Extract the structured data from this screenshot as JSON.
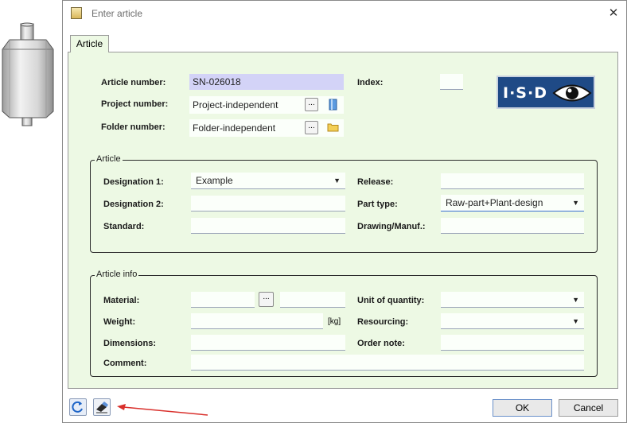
{
  "window": {
    "title": "Enter article",
    "close_glyph": "✕"
  },
  "tab": {
    "label": "Article"
  },
  "header": {
    "article_number_label": "Article number:",
    "article_number_value": "SN-026018",
    "project_number_label": "Project number:",
    "project_number_value": "Project-independent",
    "folder_number_label": "Folder number:",
    "folder_number_value": "Folder-independent",
    "index_label": "Index:",
    "index_value": "",
    "browse_label": "...",
    "logo_text": "I·S·D"
  },
  "article_group": {
    "title": "Article",
    "designation1_label": "Designation 1:",
    "designation1_value": "Example",
    "designation2_label": "Designation 2:",
    "designation2_value": "",
    "standard_label": "Standard:",
    "standard_value": "",
    "release_label": "Release:",
    "release_value": "",
    "part_type_label": "Part type:",
    "part_type_value": "Raw-part+Plant-design",
    "drawing_label": "Drawing/Manuf.:",
    "drawing_value": ""
  },
  "info_group": {
    "title": "Article info",
    "material_label": "Material:",
    "material_value": "",
    "material_extra_value": "",
    "weight_label": "Weight:",
    "weight_value": "",
    "weight_unit": "[kg]",
    "dimensions_label": "Dimensions:",
    "dimensions_value": "",
    "comment_label": "Comment:",
    "comment_value": "",
    "unit_of_quantity_label": "Unit of quantity:",
    "unit_of_quantity_value": "",
    "resourcing_label": "Resourcing:",
    "resourcing_value": "",
    "order_note_label": "Order note:",
    "order_note_value": ""
  },
  "buttons": {
    "ok": "OK",
    "cancel": "Cancel"
  },
  "icons": {
    "caret": "▼",
    "accent_arrow_color": "#d9302c"
  }
}
